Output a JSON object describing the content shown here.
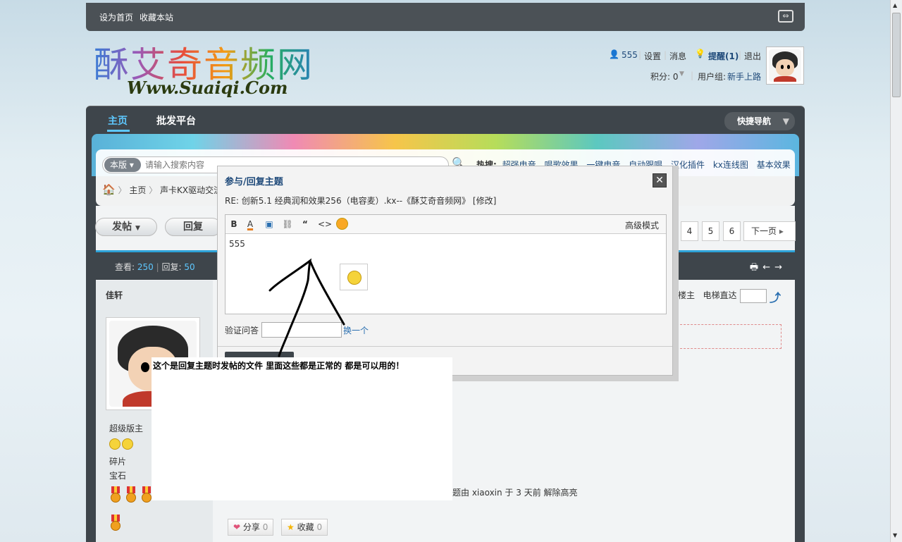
{
  "topbar": {
    "set_home": "设为首页",
    "bookmark": "收藏本站"
  },
  "logo": {
    "main": "酥艾奇音频网",
    "sub": "Www.Suaiqi.Com"
  },
  "user": {
    "name": "555",
    "settings": "设置",
    "messages": "消息",
    "reminder": "提醒(1)",
    "logout": "退出",
    "points": "积分: 0",
    "group_label": "用户组:",
    "group": "新手上路"
  },
  "nav": {
    "home": "主页",
    "bulk": "批发平台",
    "quicknav": "快捷导航"
  },
  "search": {
    "scope": "本版",
    "placeholder": "请输入搜索内容"
  },
  "hot": {
    "label": "热搜:",
    "items": [
      "超强电音",
      "唱歌效果",
      "一键电音",
      "自动跟唱",
      "汉化插件",
      "kx连线图",
      "基本效果"
    ]
  },
  "breadcrumb": {
    "home": "主页",
    "forum": "声卡KX驱动交流"
  },
  "actions": {
    "post": "发帖",
    "reply": "回复"
  },
  "pagination": {
    "pages": [
      "4",
      "5",
      "6"
    ],
    "next": "下一页"
  },
  "stats": {
    "views_label": "查看:",
    "views": "250",
    "replies_label": "回复:",
    "replies": "50"
  },
  "author": {
    "name": "佳轩",
    "rank": "超级版主",
    "line1": "碎片",
    "line2": "宝石"
  },
  "floor": {
    "owner": "楼主",
    "jump": "电梯直达"
  },
  "unhighlight": "题由 xiaoxin 于 3 天前 解除高亮",
  "share": {
    "label": "分享",
    "count": "0"
  },
  "fav": {
    "label": "收藏",
    "count": "0"
  },
  "modal": {
    "title": "参与/回复主题",
    "subject": "RE: 创新5.1 经典润和效果256（电容麦）.kx--《酥艾奇音频网》 [修改]",
    "toolbar": {
      "bold": "B",
      "color": "A",
      "quote": "“",
      "code": "<>",
      "advanced": "高级模式"
    },
    "content": "555",
    "verify_label": "验证问答",
    "verify_change": "换一个"
  },
  "overlay_note": "这个是回复主题时发帖的文件 里面这些都是正常的 都是可以用的！"
}
